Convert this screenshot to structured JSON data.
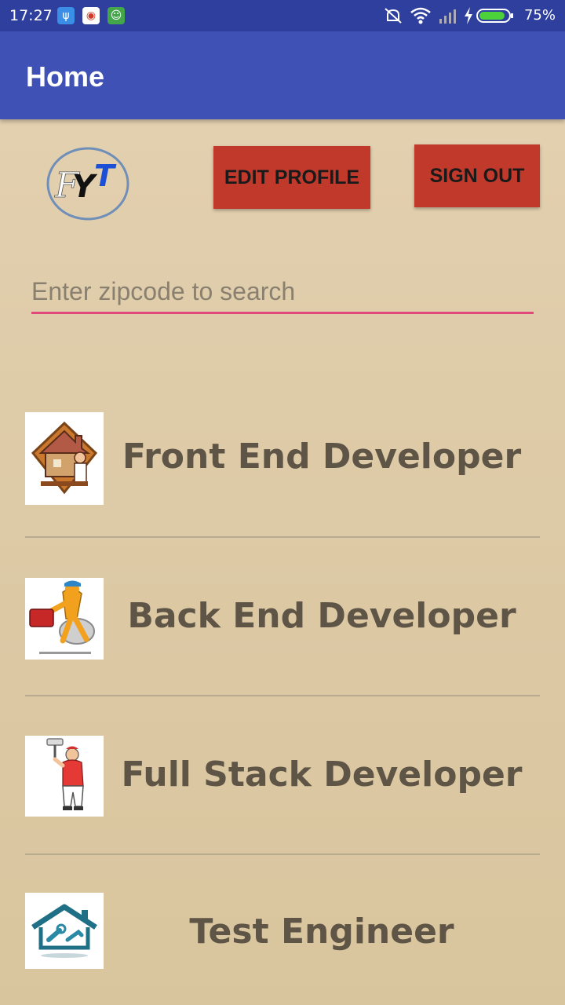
{
  "status_bar": {
    "time": "17:27",
    "battery": "75%",
    "icons": [
      "usb-icon",
      "app-notification-icon",
      "android-icon",
      "mute-icon",
      "wifi-icon",
      "signal-icon",
      "charging-icon",
      "battery-icon"
    ]
  },
  "app_bar": {
    "title": "Home"
  },
  "header": {
    "logo_text": "FYT",
    "edit_profile_label": "EDIT PROFILE",
    "sign_out_label": "SIGN OUT"
  },
  "search": {
    "placeholder": "Enter zipcode to search"
  },
  "colors": {
    "status_bar": "#2f3f9e",
    "app_bar": "#3f51b5",
    "button": "#c0392b",
    "accent_underline": "#e04a7a",
    "label_text": "#5e5547"
  },
  "list": {
    "items": [
      {
        "label": "Front End Developer",
        "icon": "house-mover-icon"
      },
      {
        "label": "Back End Developer",
        "icon": "plumber-icon"
      },
      {
        "label": "Full Stack Developer",
        "icon": "painter-icon"
      },
      {
        "label": "Test Engineer",
        "icon": "house-tools-icon"
      }
    ]
  }
}
